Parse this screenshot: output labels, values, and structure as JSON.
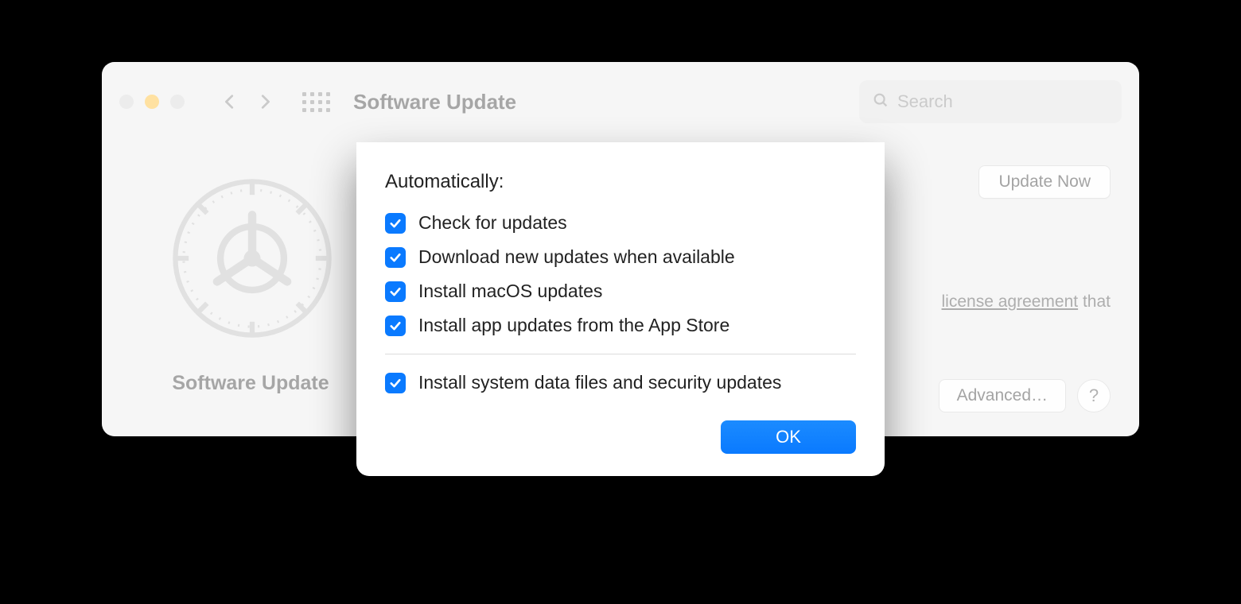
{
  "window": {
    "title": "Software Update",
    "search_placeholder": "Search"
  },
  "pane": {
    "icon_label": "Software Update",
    "update_now": "Update Now",
    "agreement_fragment_link": "license agreement",
    "agreement_fragment_tail": " that",
    "advanced": "Advanced…",
    "help": "?"
  },
  "sheet": {
    "heading": "Automatically:",
    "options": [
      {
        "label": "Check for updates",
        "checked": true
      },
      {
        "label": "Download new updates when available",
        "checked": true
      },
      {
        "label": "Install macOS updates",
        "checked": true
      },
      {
        "label": "Install app updates from the App Store",
        "checked": true
      }
    ],
    "security_option": {
      "label": "Install system data files and security updates",
      "checked": true
    },
    "ok": "OK"
  },
  "colors": {
    "accent": "#0a7aff"
  }
}
